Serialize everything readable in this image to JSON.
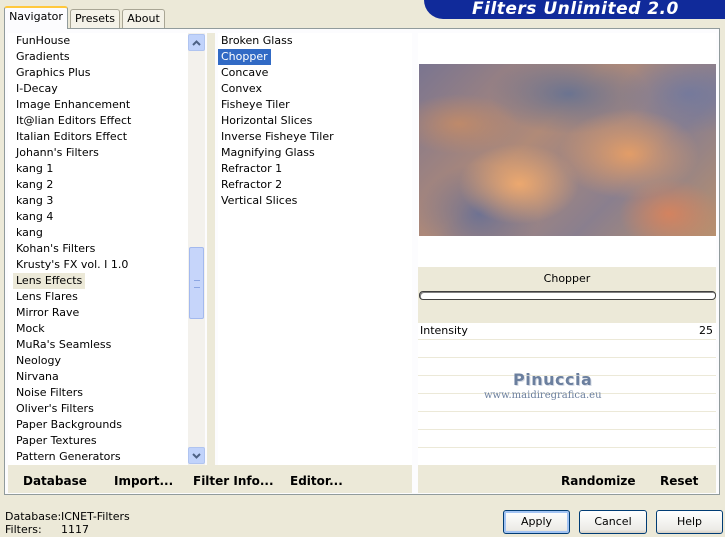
{
  "tabs": [
    {
      "label": "Navigator"
    },
    {
      "label": "Presets"
    },
    {
      "label": "About"
    }
  ],
  "title": "Filters Unlimited 2.0",
  "categories": [
    "FunHouse",
    "Gradients",
    "Graphics Plus",
    "I-Decay",
    "Image Enhancement",
    "It@lian Editors Effect",
    "Italian Editors Effect",
    "Johann's Filters",
    "kang 1",
    "kang 2",
    "kang 3",
    "kang 4",
    "kang",
    "Kohan's Filters",
    "Krusty's FX vol. I 1.0",
    "Lens Effects",
    "Lens Flares",
    "Mirror Rave",
    "Mock",
    "MuRa's Seamless",
    "Neology",
    "Nirvana",
    "Noise Filters",
    "Oliver's Filters",
    "Paper Backgrounds",
    "Paper Textures",
    "Pattern Generators"
  ],
  "selected_category": "Lens Effects",
  "filters": [
    "Broken Glass",
    "Chopper",
    "Concave",
    "Convex",
    "Fisheye Tiler",
    "Horizontal Slices",
    "Inverse Fisheye Tiler",
    "Magnifying Glass",
    "Refractor 1",
    "Refractor 2",
    "Vertical Slices"
  ],
  "selected_filter": "Chopper",
  "left_buttons": {
    "database": "Database",
    "import": "Import...",
    "filter_info": "Filter Info...",
    "editor": "Editor..."
  },
  "right_buttons": {
    "randomize": "Randomize",
    "reset": "Reset"
  },
  "preview": {
    "filter_name": "Chopper"
  },
  "params": [
    {
      "label": "Intensity",
      "value": "25"
    }
  ],
  "watermark": {
    "name": "Pinuccia",
    "url": "www.maidiregrafica.eu"
  },
  "status": {
    "database_label": "Database:",
    "database_value": "ICNET-Filters",
    "filters_label": "Filters:",
    "filters_value": "1117"
  },
  "dialog_buttons": {
    "apply": "Apply",
    "cancel": "Cancel",
    "help": "Help"
  },
  "colors": {
    "selection": "#316ac5",
    "banner": "#102a9a",
    "face": "#ece9d8"
  }
}
